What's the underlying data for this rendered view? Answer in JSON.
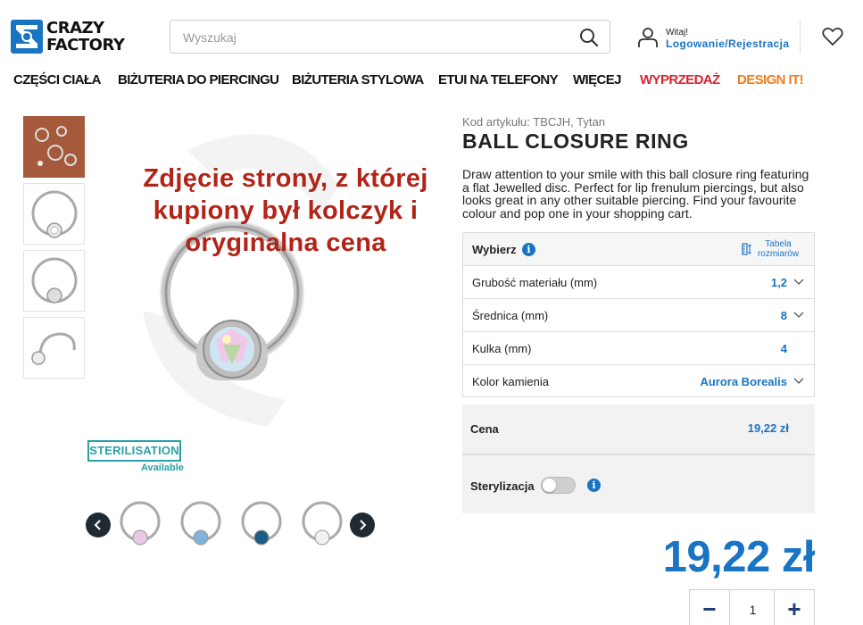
{
  "brand": {
    "line1": "CRAZY",
    "line2": "FACTORY",
    "color": "#1a74c4"
  },
  "search": {
    "placeholder": "Wyszukaj"
  },
  "account": {
    "greeting": "Witaj!",
    "login_label": "Logowanie/Rejestracja"
  },
  "nav": {
    "items": [
      {
        "label": "CZĘŚCI CIAŁA"
      },
      {
        "label": "BIŻUTERIA DO PIERCINGU"
      },
      {
        "label": "BIŻUTERIA STYLOWA"
      },
      {
        "label": "ETUI NA TELEFONY"
      },
      {
        "label": "WIĘCEJ"
      },
      {
        "label": "WYPRZEDAŻ",
        "color": "#d9232e"
      },
      {
        "label": "DESIGN IT!",
        "color": "#ef7d1a"
      }
    ]
  },
  "gallery": {
    "overlay_text": "Zdjęcie strony, z której kupiony był kolczyk i oryginalna cena",
    "sterilisation_badge": "STERILISATION",
    "sterilisation_sub": "Available"
  },
  "product": {
    "sku": "Kod artykułu: TBCJH, Tytan",
    "title": "BALL CLOSURE RING",
    "description": "Draw attention to your smile with this ball closure ring featuring a flat Jewelled disc. Perfect for lip frenulum piercings, but also looks great in any other suitable piercing. Find your favourite colour and pop one in your shopping cart."
  },
  "options": {
    "header_label": "Wybierz",
    "size_chart_label": "Tabela rozmiarów",
    "rows": [
      {
        "label": "Grubość materiału (mm)",
        "value": "1,2"
      },
      {
        "label": "Średnica (mm)",
        "value": "8"
      },
      {
        "label": "Kulka (mm)",
        "value": "4"
      },
      {
        "label": "Kolor kamienia",
        "value": "Aurora Borealis"
      }
    ]
  },
  "pricing": {
    "price_label": "Cena",
    "price_value": "19,22 zł",
    "sterilisation_label": "Sterylizacja",
    "sterilisation_enabled": false,
    "big_price": "19,22 zł"
  },
  "quantity": {
    "minus": "−",
    "value": "1",
    "plus": "+"
  },
  "icons": {
    "search": "search-icon",
    "user": "user-icon",
    "wishlist": "heart-icon",
    "info": "info-icon",
    "size_chart": "ruler-icon",
    "chevron": "chevron-down-icon",
    "prev": "chevron-left-icon",
    "next": "chevron-right-icon"
  }
}
